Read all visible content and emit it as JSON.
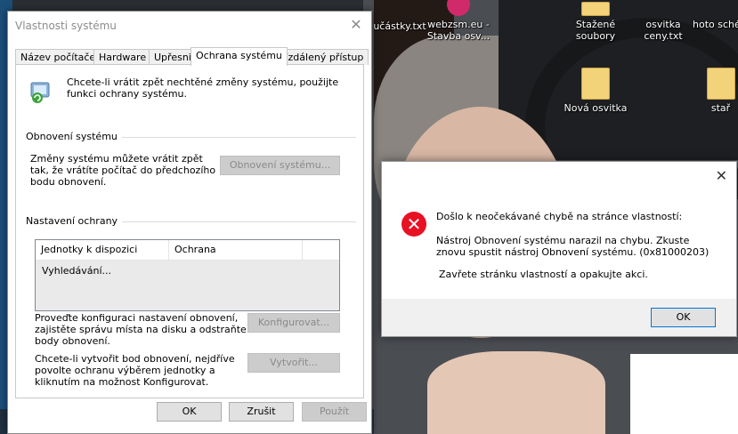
{
  "desktop": {
    "icons": [
      {
        "label": "učástky.txt",
        "kind": "file"
      },
      {
        "label": "webzsm.eu - Stavba osv...",
        "kind": "app"
      },
      {
        "label": "Stažené soubory",
        "kind": "folder"
      },
      {
        "label": "osvitka ceny.txt",
        "kind": "file"
      },
      {
        "label": "hoto schém",
        "kind": "file"
      },
      {
        "label": "Nová osvitka",
        "kind": "folder"
      },
      {
        "label": "stař",
        "kind": "folder"
      }
    ]
  },
  "system_properties": {
    "title": "Vlastnosti systému",
    "close_label": "✕",
    "tabs": [
      {
        "label": "Název počítače"
      },
      {
        "label": "Hardware"
      },
      {
        "label": "Upřesnit"
      },
      {
        "label": "Ochrana systému"
      },
      {
        "label": "Vzdálený přístup"
      }
    ],
    "active_tab": "Ochrana systému",
    "intro_text": "Chcete-li vrátit zpět nechtěné změny systému, použijte funkci ochrany systému.",
    "restore_group": {
      "title": "Obnovení systému",
      "description": "Změny systému můžete vrátit zpět tak, že vrátíte počítač do předchozího bodu obnovení.",
      "button_label": "Obnovení systému..."
    },
    "protection_group": {
      "title": "Nastavení ochrany",
      "columns": [
        "Jednotky k dispozici",
        "Ochrana"
      ],
      "status_text": "Vyhledávání..."
    },
    "configure": {
      "description": "Proveďte konfiguraci nastavení obnovení, zajistěte správu místa na disku a odstraňte body obnovení.",
      "button_label": "Konfigurovat..."
    },
    "create": {
      "description": "Chcete-li vytvořit bod obnovení, nejdříve povolte ochranu výběrem jednotky a kliknutím na možnost Konfigurovat.",
      "button_label": "Vytvořit..."
    },
    "buttons": {
      "ok": "OK",
      "cancel": "Zrušit",
      "apply": "Použít"
    }
  },
  "error_dialog": {
    "close_label": "✕",
    "icon_glyph": "✕",
    "heading": "Došlo k neočekávané chybě na stránce vlastností:",
    "message": "Nástroj Obnovení systému narazil na chybu. Zkuste znovu spustit nástroj Obnovení systému. (0x81000203)",
    "instruction": "Zavřete stránku vlastností a opakujte akci.",
    "ok_label": "OK",
    "accent_color": "#e81123"
  }
}
